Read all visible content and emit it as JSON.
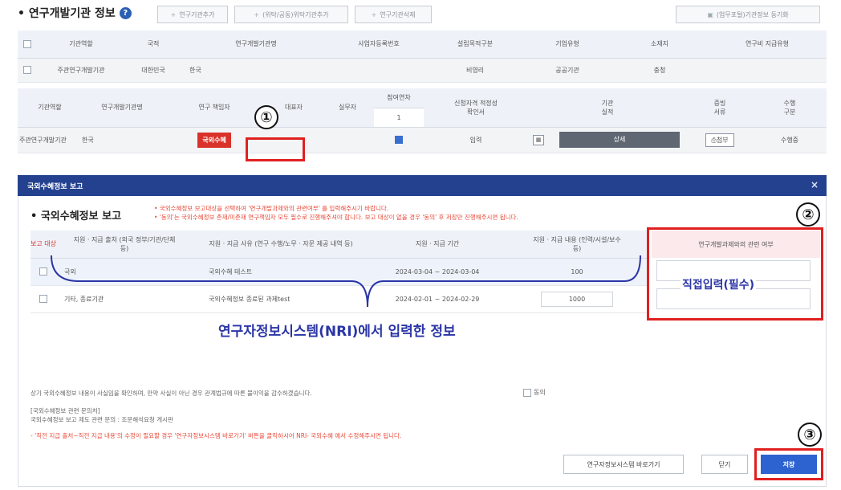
{
  "section": {
    "title": "• 연구개발기관 정보",
    "help_icon": "?",
    "btn_add_org": "연구기관추가",
    "btn_add_delegate": "(위탁/공동)위탁기관추가",
    "btn_delete_org": "연구기관삭제",
    "btn_sync": "(업무포털)기관정보 동기화",
    "add_icon": "+"
  },
  "org_table": {
    "headers": [
      "기관역할",
      "국적",
      "연구개발기관명",
      "사업자등록번호",
      "설립목적구분",
      "기업유형",
      "소재지",
      "연구비 지급유형"
    ],
    "row": [
      "주관연구개발기관",
      "대한민국",
      "한국",
      "",
      "비영리",
      "공공기관",
      "충청",
      ""
    ]
  },
  "researcher_table": {
    "headers": {
      "role": "기관역할",
      "org_name": "연구개발기관명",
      "pi": "연구 책임자",
      "ceo": "대표자",
      "staff": "실무자",
      "year": "참여연차",
      "year_value": "1",
      "qual": "신청자격 적정성 확인서",
      "perf": "기관 실적",
      "docs": "증빙 서류",
      "type": "수행 구분"
    },
    "row": {
      "role": "주관연구개발기관",
      "org_name": "한국",
      "pi_badge": "국외수혜",
      "qual_action": "입력",
      "perf_action": "상세",
      "docs_action": "첨부",
      "type": "수행중"
    }
  },
  "markers": {
    "one": "①",
    "two": "②",
    "three": "③"
  },
  "modal": {
    "title": "국외수혜정보 보고",
    "close": "×",
    "subtitle": "• 국외수혜정보 보고",
    "notice_line1": "• 국외수혜정보 보고대상을 선택하여 '연구개발과제와의 관련여부' 를 입력해주시기 바랍니다.",
    "notice_line2": "• '동의'는 국외수혜정보 존재/미존재 연구책임자 모두 필수로 진행해주셔야 합니다. 보고 대상이 없을 경우 '동의' 후 저장만 진행해주시면 됩니다.",
    "table_headers": {
      "target": "보고 대상",
      "source": "지원 · 지급 출처 (외국 정부/기관/단체 등)",
      "reason": "지원 · 지급 사유 (연구 수행/노무 · 자문 제공 내역 등)",
      "period": "지원 · 지급 기간",
      "content": "지원 · 지급 내용 (인력/시설/보수 등)",
      "relation": "연구개발과제와의 관련 여부"
    },
    "rows": [
      {
        "source": "국외",
        "reason": "국외수혜 테스트",
        "period": "2024-03-04 ~ 2024-03-04",
        "content": "100"
      },
      {
        "source": "기타, 종료기관",
        "reason": "국외수혜정보 종료된 과제test",
        "period": "2024-02-01 ~ 2024-02-29",
        "content": "1000"
      }
    ],
    "annotation_direct": "직접입력(필수)",
    "annotation_nri": "연구자정보시스템(NRI)에서 입력한 정보",
    "agree_text": "상기 국외수혜정보 내용이 사실임을 확인하며, 만약 사실이 아닌 경우 관계법규에 따른 불이익을 감수하겠습니다.",
    "agree_label": "동의",
    "contact_title": "[국외수혜정보 관련 문의처]",
    "contact_body": "국외수혜정보 보고 제도 관련 문의 : 조문해석요청 게시판",
    "footer_notice": "- '직전 지급 출처~직전 지급 내용'의 수정이 필요할 경우 '연구자정보시스템 바로가기' 버튼을 클릭하시어 NRI- 국외수혜 에서 수정해주시면 됩니다.",
    "btn_nri": "연구자정보시스템 바로가기",
    "btn_close": "닫기",
    "btn_save": "저장"
  },
  "colors": {
    "accent": "#23418f",
    "highlight": "#e02020",
    "annotation": "#2a35a6"
  }
}
